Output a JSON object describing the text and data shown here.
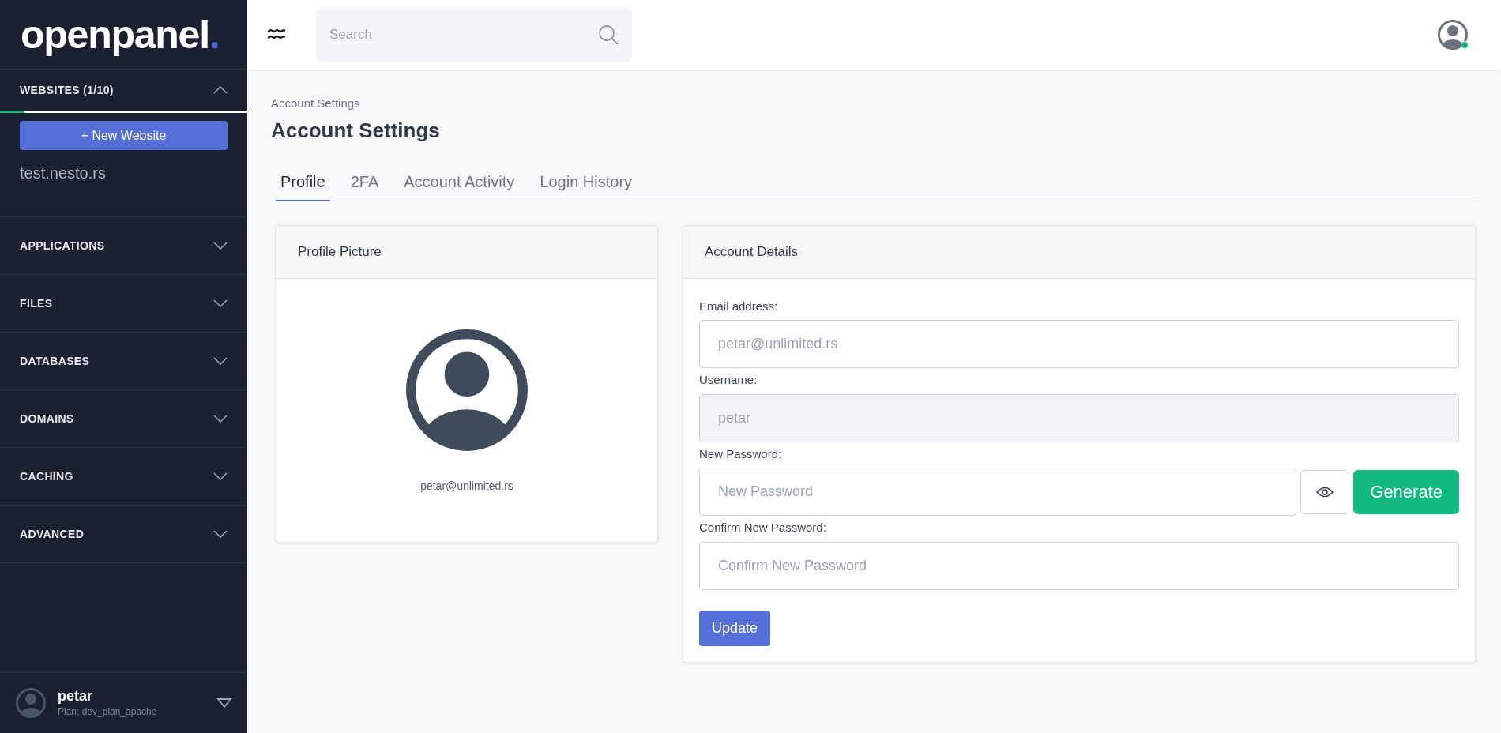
{
  "sidebar": {
    "logo": {
      "text": "openpanel",
      "dot": "."
    },
    "websites": {
      "title": "WEBSITES (1/10)",
      "expanded": true,
      "level": 0.1,
      "new_button": "+ New Website",
      "items": [
        "test.nesto.rs"
      ]
    },
    "sections": [
      {
        "title": "APPLICATIONS",
        "expanded": false
      },
      {
        "title": "FILES",
        "expanded": false
      },
      {
        "title": "DATABASES",
        "expanded": false
      },
      {
        "title": "DOMAINS",
        "expanded": false
      },
      {
        "title": "CACHING",
        "expanded": false
      },
      {
        "title": "ADVANCED",
        "expanded": false
      }
    ],
    "user": {
      "name": "petar",
      "plan": "Plan: dev_plan_apache"
    }
  },
  "header": {
    "search": {
      "placeholder": "Search"
    }
  },
  "breadcrumb": "Account Settings",
  "title": "Account Settings",
  "tabs": [
    {
      "label": "Profile",
      "selected": true
    },
    {
      "label": "2FA",
      "selected": false
    },
    {
      "label": "Account Activity",
      "selected": false
    },
    {
      "label": "Login History",
      "selected": false
    }
  ],
  "profile_card": {
    "title": "Profile Picture",
    "email": "petar@unlimited.rs"
  },
  "account_card": {
    "title": "Account Details",
    "fields": [
      {
        "label": "Email address:",
        "placeholder": "petar@unlimited.rs",
        "disabled": false,
        "kind": "text"
      },
      {
        "label": "Username:",
        "placeholder": "petar",
        "disabled": true,
        "kind": "text"
      },
      {
        "label": "New Password:",
        "placeholder": "New Password",
        "disabled": false,
        "kind": "password",
        "generate": "Generate"
      },
      {
        "label": "Confirm New Password:",
        "placeholder": "Confirm New Password",
        "disabled": false,
        "kind": "text"
      }
    ],
    "submit": "Update"
  }
}
